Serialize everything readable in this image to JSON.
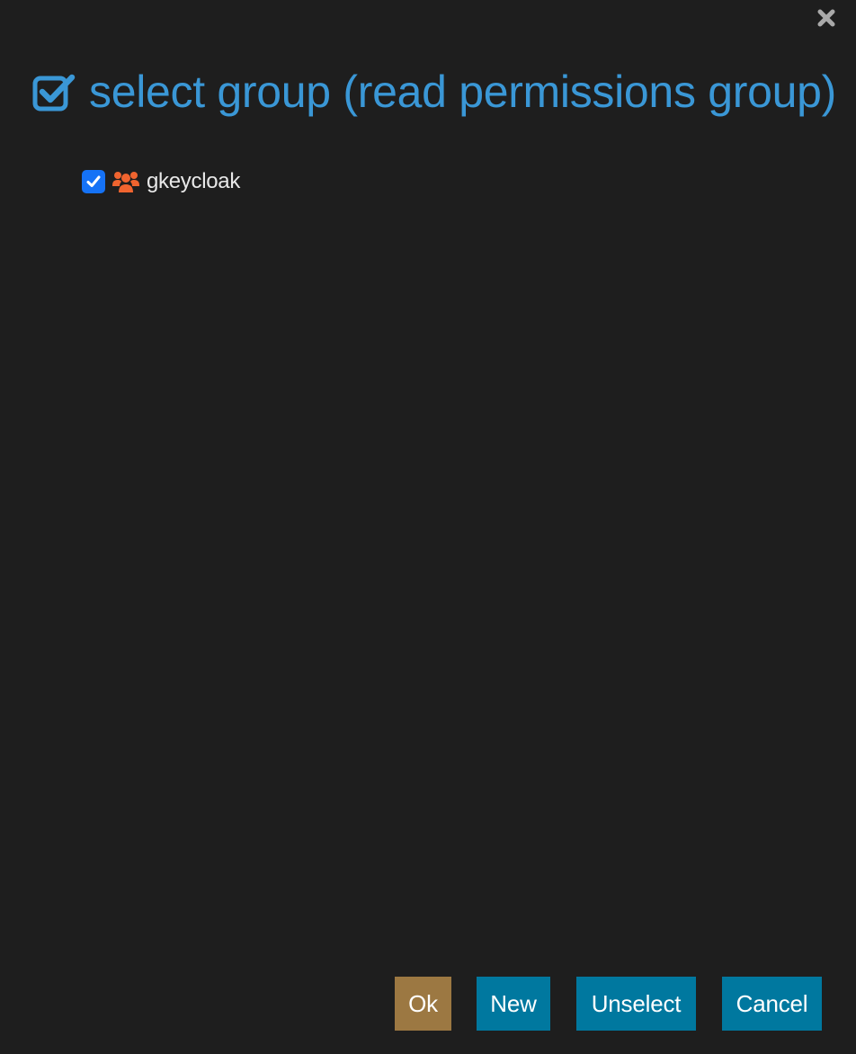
{
  "dialog": {
    "title": "select group (read permissions group)",
    "title_icon": "check-square-icon",
    "close_icon": "close-icon",
    "accent_color": "#3a97d6",
    "background_color": "#1e1e1e"
  },
  "tree": {
    "items": [
      {
        "label": "gkeycloak",
        "checked": true,
        "icon": "users-group-icon",
        "icon_color": "#f0642f"
      }
    ]
  },
  "buttons": {
    "ok_label": "Ok",
    "new_label": "New",
    "unselect_label": "Unselect",
    "cancel_label": "Cancel",
    "ok_color": "#9c7842",
    "primary_color": "#00789f"
  }
}
